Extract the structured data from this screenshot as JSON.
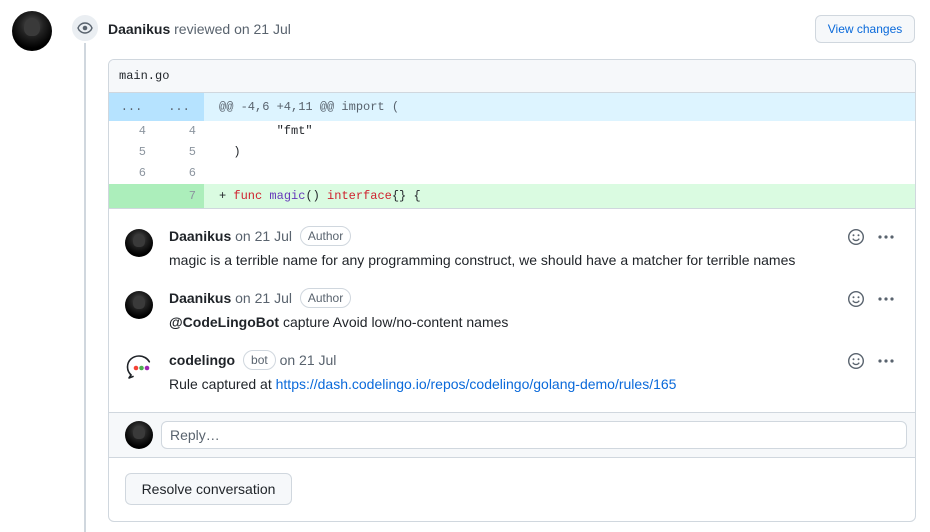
{
  "review": {
    "author": "Daanikus",
    "action": "reviewed",
    "date": "on 21 Jul",
    "view_changes_label": "View changes"
  },
  "file": {
    "name": "main.go",
    "hunk_left": "...",
    "hunk_right": "...",
    "hunk_header": "@@ -4,6 +4,11 @@ import (",
    "lines": [
      {
        "old": "4",
        "new": "4",
        "code": "        \"fmt\""
      },
      {
        "old": "5",
        "new": "5",
        "code": "  )"
      },
      {
        "old": "6",
        "new": "6",
        "code": ""
      }
    ],
    "added": {
      "new": "7",
      "prefix": "+ ",
      "kw1": "func",
      "fn": "magic",
      "mid": "() ",
      "kw2": "interface",
      "tail": "{} {"
    }
  },
  "comments": [
    {
      "author": "Daanikus",
      "date": "on 21 Jul",
      "badge": "Author",
      "body": "magic is a terrible name for any programming construct, we should have a matcher for terrible names"
    },
    {
      "author": "Daanikus",
      "date": "on 21 Jul",
      "badge": "Author",
      "mention": "@CodeLingoBot",
      "body": " capture Avoid low/no-content names"
    },
    {
      "author": "codelingo",
      "date": "on 21 Jul",
      "badge": "bot",
      "body_prefix": "Rule captured at ",
      "link": "https://dash.codelingo.io/repos/codelingo/golang-demo/rules/165"
    }
  ],
  "reply": {
    "placeholder": "Reply…"
  },
  "resolve_label": "Resolve conversation",
  "colors": {
    "link": "#0969da",
    "hunk_bg": "#ddf4ff",
    "added_bg": "#dafbe1",
    "bot_dots": [
      "#f44336",
      "#4caf50",
      "#2196f3",
      "#9c27b0"
    ]
  },
  "icons": {
    "timeline": "eye-icon",
    "reaction": "smiley-icon",
    "more": "kebab-horizontal-icon"
  }
}
